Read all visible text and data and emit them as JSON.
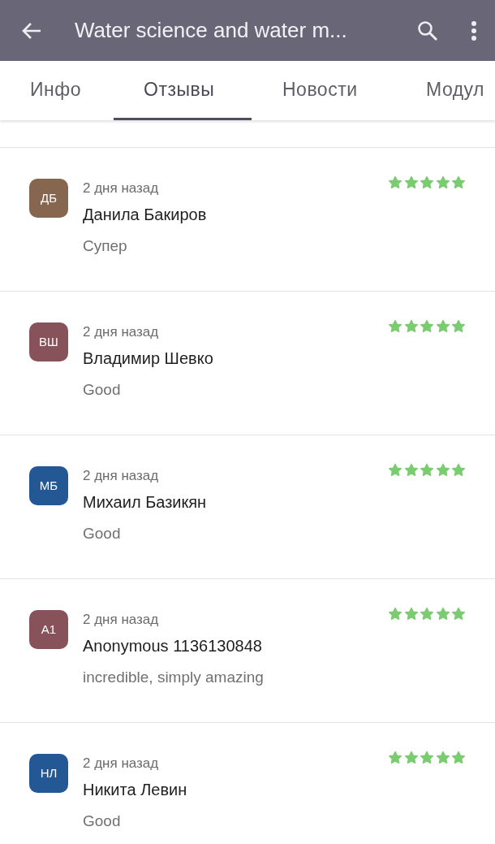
{
  "app_bar": {
    "title": "Water science and water m..."
  },
  "tabs": [
    {
      "label": "Инфо",
      "selected": false
    },
    {
      "label": "Отзывы",
      "selected": true
    },
    {
      "label": "Новости",
      "selected": false
    },
    {
      "label": "Модул",
      "selected": false
    }
  ],
  "reviews": [
    {
      "initials": "ДБ",
      "color": "#86664f",
      "time": "2 дня назад",
      "author": "Данила Бакиров",
      "text": "Супер",
      "stars": 5
    },
    {
      "initials": "ВШ",
      "color": "#87525a",
      "time": "2 дня назад",
      "author": "Владимир Шевко",
      "text": "Good",
      "stars": 5
    },
    {
      "initials": "МБ",
      "color": "#245894",
      "time": "2 дня назад",
      "author": "Михаил Базикян",
      "text": "Good",
      "stars": 5
    },
    {
      "initials": "А1",
      "color": "#87525a",
      "time": "2 дня назад",
      "author": "Anonymous 1136130848",
      "text": "incredible, simply amazing",
      "stars": 5
    },
    {
      "initials": "НЛ",
      "color": "#245894",
      "time": "2 дня назад",
      "author": "Никита Левин",
      "text": "Good",
      "stars": 5
    }
  ]
}
